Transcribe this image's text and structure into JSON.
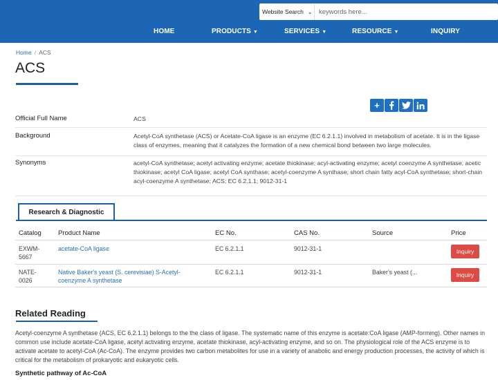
{
  "header": {
    "search_select_value": "Website Search",
    "search_placeholder": "keywords here...",
    "nav": [
      {
        "label": "HOME"
      },
      {
        "label": "PRODUCTS"
      },
      {
        "label": "SERVICES"
      },
      {
        "label": "RESOURCE"
      },
      {
        "label": "INQUIRY"
      }
    ]
  },
  "breadcrumb": {
    "home": "Home",
    "sep": "/",
    "current": "ACS"
  },
  "page_title": "ACS",
  "share_icons": [
    "share-plus-icon",
    "facebook-icon",
    "twitter-icon",
    "linkedin-icon"
  ],
  "info": [
    {
      "label": "Official Full Name",
      "value": "ACS"
    },
    {
      "label": "Background",
      "value": "Acetyl-CoA synthetase (ACS) or Acetate-CoA ligase is an enzyme (EC 6.2.1.1) involved in metabolism of acetate. It is in the ligase class of enzymes, meaning that it catalyzes the formation of a new chemical bond between two large molecules."
    },
    {
      "label": "Synonyms",
      "value": "acetyl-CoA synthetase; acetyl activating enzyme; acetate thiokinase; acyl-activating enzyme; acetyl coenzyme A synthetase; acetic thiokinase; acetyl CoA ligase; acetyl CoA synthase; acetyl-coenzyme A synthase; short chain fatty acyl-CoA synthetase; short-chain acyl-coenzyme A synthetase; ACS; EC 6.2.1.1; 9012-31-1"
    }
  ],
  "tab_label": "Research & Diagnostic",
  "table": {
    "columns": [
      "Catalog",
      "Product Name",
      "EC No.",
      "CAS No.",
      "Source",
      "Price"
    ],
    "rows": [
      {
        "catalog": "EXWM-5667",
        "product": "acetate-CoA ligase",
        "ec": "EC 6.2.1.1",
        "cas": "9012-31-1",
        "source": "",
        "price_button": "Inquiry"
      },
      {
        "catalog": "NATE-0026",
        "product": "Native Baker's yeast (S. cerevisiae) S-Acetyl-coenzyme A synthetase",
        "ec": "EC 6.2.1.1",
        "cas": "9012-31-1",
        "source": "Baker's yeast (...",
        "price_button": "Inquiry"
      }
    ]
  },
  "related": {
    "title": "Related Reading",
    "body": "Acetyl-coenzyme A synthetase (ACS, EC 6.2.1.1) belongs to the the class of ligase. The systematic name of this enzyme is acetate:CoA ligase (AMP-forming). Other names in common use include acetate-CoA ligase, acetyl activating enzyme, acetate thiokinase, acyl-activating enzyme, and so on. The physiological role of the ACS enzyme is to activate acetate to acetyl-CoA (Ac-CoA). The enzyme provides two carbon metabolites for use in a variety of anabolic and energy production processes, the activity of which is critical for the metabolism of prokaryotic and eukaryotic cells.",
    "subheading": "Synthetic pathway of Ac-CoA"
  },
  "colors": {
    "brand": "#1d66b6",
    "accent_line": "#1d5f9e",
    "link": "#2a6fb5",
    "inquiry_button": "#dd4b47"
  }
}
